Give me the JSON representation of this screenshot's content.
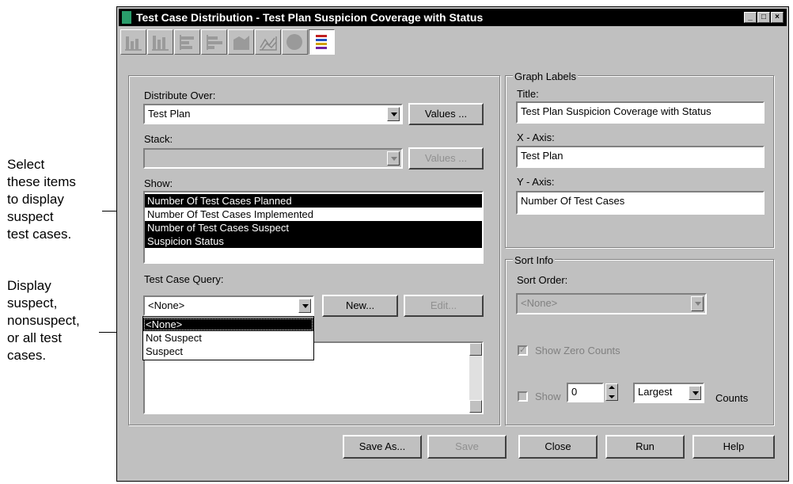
{
  "annotations": {
    "first_lines": [
      "Select",
      "these items",
      "to display",
      "suspect",
      "test cases."
    ],
    "second_lines": [
      "Display",
      "suspect,",
      "nonsuspect,",
      "or all test",
      "cases."
    ]
  },
  "window": {
    "title": "Test Case Distribution  - Test Plan Suspicion Coverage with Status",
    "toolbar_icons": [
      "bar-chart-icon",
      "stacked-bar-chart-icon",
      "horizontal-bar-chart-icon",
      "stacked-horizontal-bar-icon",
      "area-chart-icon",
      "3d-chart-icon",
      "pie-chart-icon",
      "data-grid-icon"
    ],
    "toolbar_active_index": 7
  },
  "distribute": {
    "label": "Distribute Over:",
    "value": "Test Plan",
    "values_button": "Values ..."
  },
  "stack": {
    "label": "Stack:",
    "value": "",
    "values_button": "Values ..."
  },
  "show": {
    "label": "Show:",
    "items": [
      {
        "label": "Number Of Test Cases Planned",
        "selected": true
      },
      {
        "label": "Number Of Test Cases Implemented",
        "selected": false
      },
      {
        "label": "Number of Test Cases Suspect",
        "selected": true
      },
      {
        "label": "Suspicion Status",
        "selected": true
      }
    ]
  },
  "query": {
    "label": "Test Case Query:",
    "value": "<None>",
    "new_button": "New...",
    "edit_button": "Edit...",
    "options": [
      {
        "label": "<None>",
        "selected": true
      },
      {
        "label": "Not Suspect",
        "selected": false
      },
      {
        "label": "Suspect",
        "selected": false
      }
    ]
  },
  "graph_labels": {
    "legend": "Graph Labels",
    "title_label": "Title:",
    "title_value": "Test Plan Suspicion Coverage with Status",
    "x_label": "X - Axis:",
    "x_value": "Test Plan",
    "y_label": "Y - Axis:",
    "y_value": "Number Of Test Cases"
  },
  "sort_info": {
    "legend": "Sort Info",
    "order_label": "Sort Order:",
    "order_value": "<None>",
    "show_zero_label": "Show Zero Counts",
    "show_zero_checked": true,
    "show_label": "Show",
    "show_count": "0",
    "largest_value": "Largest",
    "counts_label": "Counts"
  },
  "buttons": {
    "save_as": "Save As...",
    "save": "Save",
    "close": "Close",
    "run": "Run",
    "help": "Help"
  }
}
